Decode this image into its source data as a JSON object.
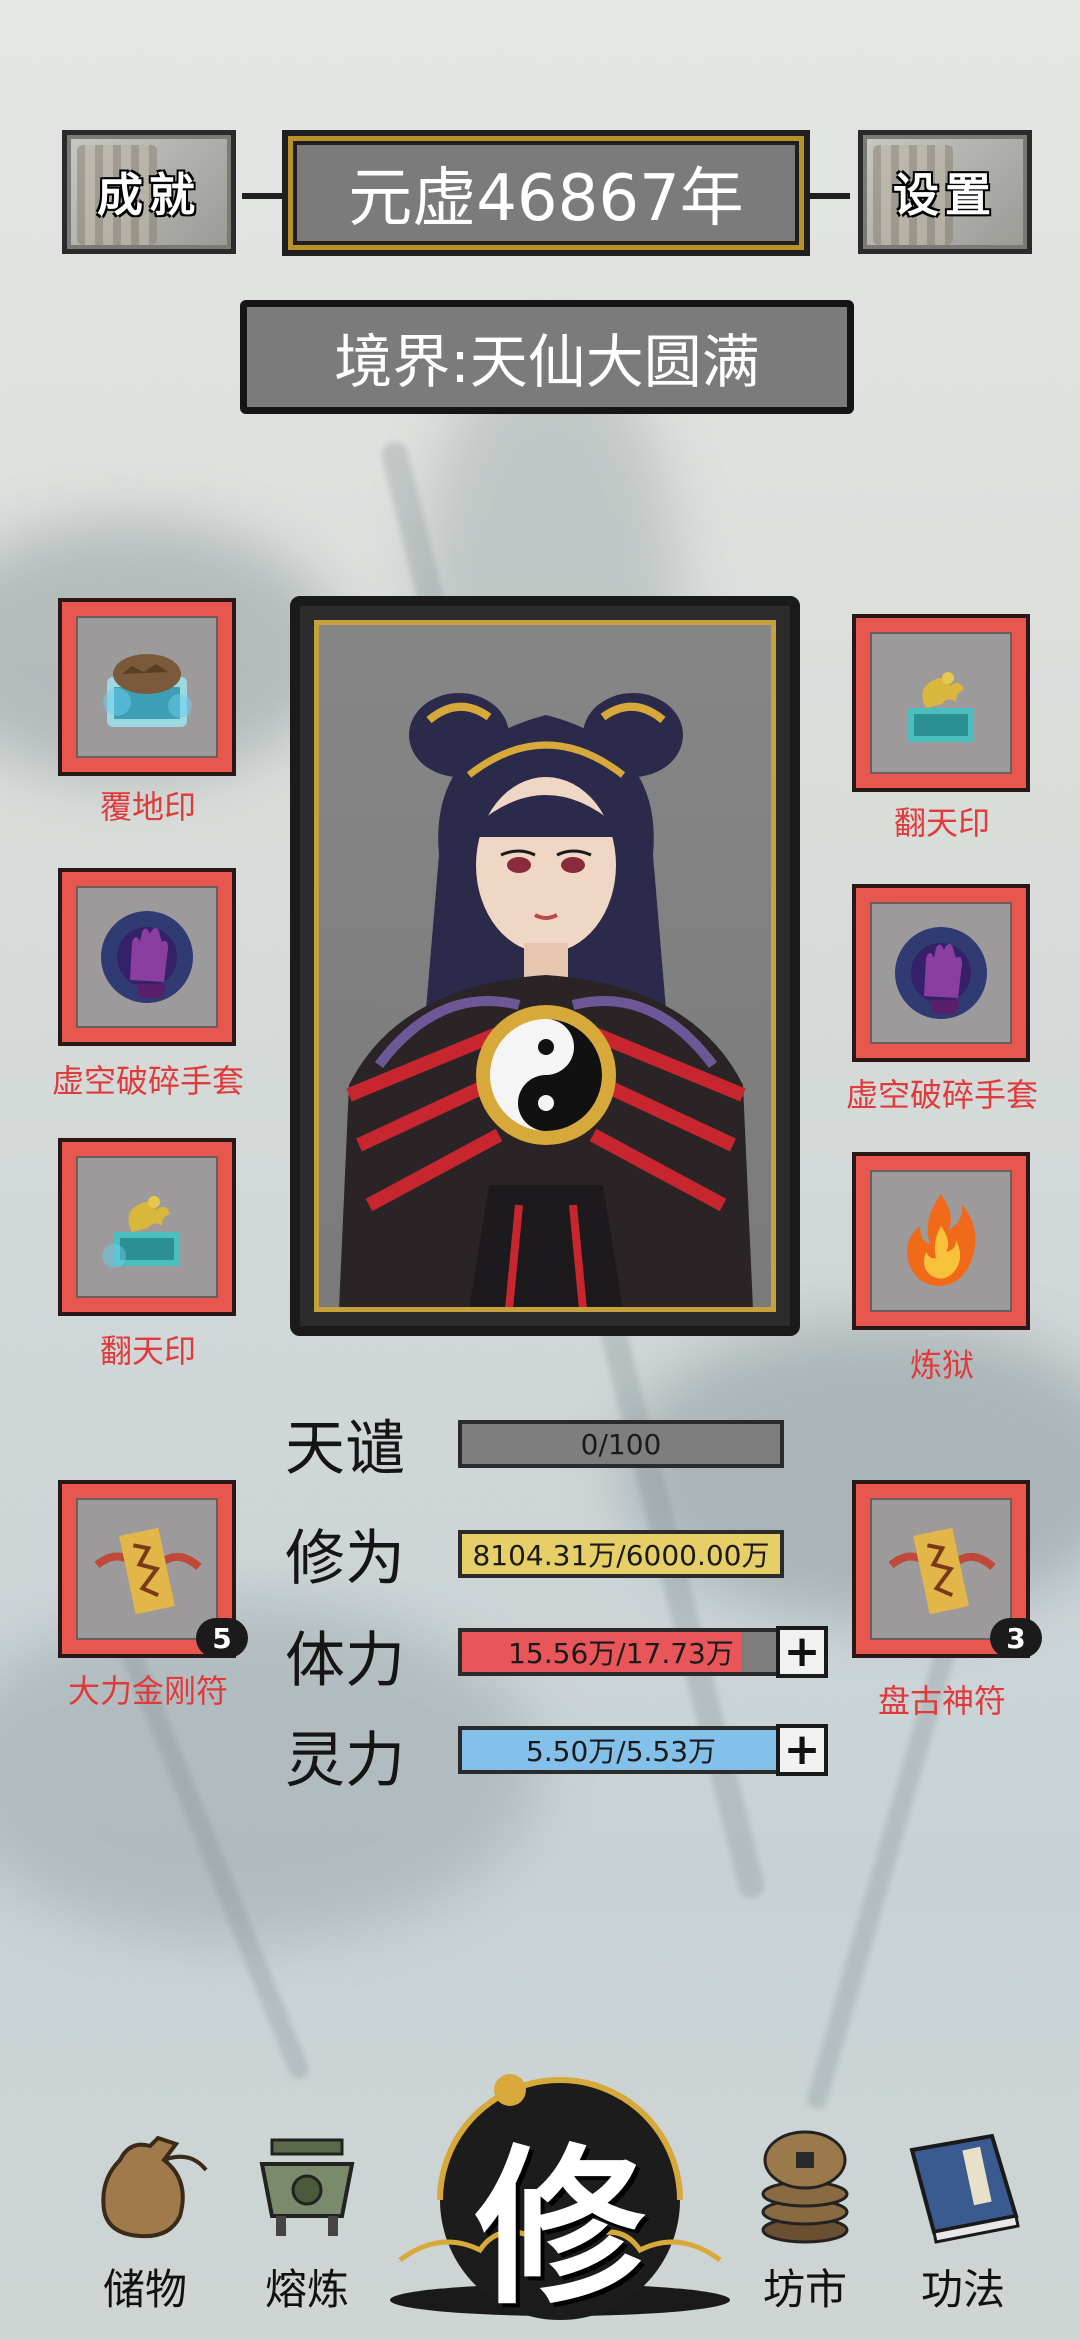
{
  "header": {
    "achievements_label": "成就",
    "year_text": "元虚46867年",
    "settings_label": "设置",
    "realm_text": "境界:天仙大圆满"
  },
  "left_slots": [
    {
      "label": "覆地印",
      "icon": "turtle-seal-icon"
    },
    {
      "label": "虚空破碎手套",
      "icon": "void-glove-icon"
    },
    {
      "label": "翻天印",
      "icon": "dragon-seal-icon"
    },
    {
      "label": "大力金刚符",
      "icon": "talisman-scroll-icon",
      "count": "5"
    }
  ],
  "right_slots": [
    {
      "label": "翻天印",
      "icon": "dragon-seal-icon"
    },
    {
      "label": "虚空破碎手套",
      "icon": "void-glove-icon"
    },
    {
      "label": "炼狱",
      "icon": "flame-icon"
    },
    {
      "label": "盘古神符",
      "icon": "talisman-scroll-icon",
      "count": "3"
    }
  ],
  "stats": {
    "tribulation": {
      "label": "天谴",
      "text": "0/100",
      "fraction": 0.0,
      "color": "#7e7e7e"
    },
    "cultivation": {
      "label": "修为",
      "text": "8104.31万/6000.00万",
      "fraction": 1.0,
      "color": "#e6cf66"
    },
    "stamina": {
      "label": "体力",
      "text": "15.56万/17.73万",
      "fraction": 0.878,
      "color": "#e8565a"
    },
    "spirit": {
      "label": "灵力",
      "text": "5.50万/5.53万",
      "fraction": 0.995,
      "color": "#84c1ea"
    },
    "plus_symbol": "+"
  },
  "nav": {
    "storage": "储物",
    "smelting": "熔炼",
    "cultivate": "修",
    "market": "坊市",
    "techniques": "功法"
  }
}
